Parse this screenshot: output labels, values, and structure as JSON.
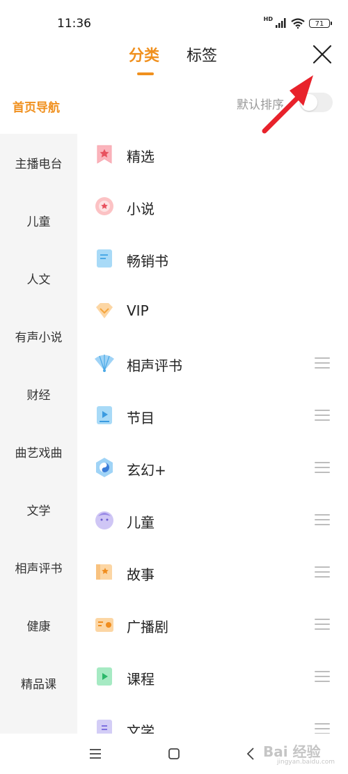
{
  "status_bar": {
    "time": "11:36",
    "hd_label": "HD",
    "battery": "71"
  },
  "tabs": [
    {
      "label": "分类",
      "active": true
    },
    {
      "label": "标签",
      "active": false
    }
  ],
  "sidebar": {
    "home_nav": "首页导航",
    "items": [
      "主播电台",
      "儿童",
      "人文",
      "有声小说",
      "财经",
      "曲艺戏曲",
      "文学",
      "相声评书",
      "健康",
      "精品课"
    ]
  },
  "sort": {
    "label": "默认排序",
    "enabled": false
  },
  "categories": [
    {
      "label": "精选",
      "icon": "bookmark-star-icon",
      "draggable": false
    },
    {
      "label": "小说",
      "icon": "badge-star-icon",
      "draggable": false
    },
    {
      "label": "畅销书",
      "icon": "book-icon",
      "draggable": false
    },
    {
      "label": "VIP",
      "icon": "diamond-icon",
      "draggable": false
    },
    {
      "label": "相声评书",
      "icon": "fan-icon",
      "draggable": true
    },
    {
      "label": "节目",
      "icon": "play-screen-icon",
      "draggable": true
    },
    {
      "label": "玄幻+",
      "icon": "yin-yang-icon",
      "draggable": true
    },
    {
      "label": "儿童",
      "icon": "baby-face-icon",
      "draggable": true
    },
    {
      "label": "故事",
      "icon": "story-book-icon",
      "draggable": true
    },
    {
      "label": "广播剧",
      "icon": "radio-icon",
      "draggable": true
    },
    {
      "label": "课程",
      "icon": "play-course-icon",
      "draggable": true
    },
    {
      "label": "文学",
      "icon": "literature-book-icon",
      "draggable": true
    }
  ],
  "watermark": {
    "text": "Bai 经验",
    "sub": "jingyan.baidu.com"
  },
  "colors": {
    "accent": "#f0901e",
    "sidebar_bg": "#f5f5f5",
    "arrow": "#e8222b"
  }
}
